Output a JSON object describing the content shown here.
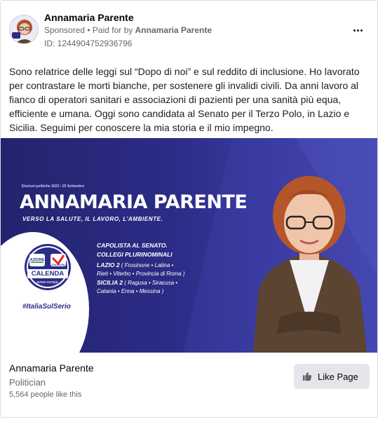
{
  "advertiser": {
    "name": "Annamaria Parente",
    "sponsored_label": "Sponsored",
    "paid_prefix": " • Paid for by ",
    "paid_by": "Annamaria Parente",
    "ad_id": "ID: 1244904752936796"
  },
  "post": {
    "body": "Sono relatrice delle leggi sul “Dopo di noi” e sul reddito di inclusione. Ho lavorato per contrastare le morti bianche, per sostenere gli invalidi civili. Da anni lavoro al fianco di operatori sanitari e associazioni di pazienti per una sanità più equa, efficiente e umana. Oggi sono candidata al Senato per il Terzo Polo, in Lazio e Sicilia. Seguimi per conoscere la mia storia e il mio impegno."
  },
  "banner": {
    "subtitle": "Elezioni politiche 2022 • 25 Settembre",
    "name": "ANNAMARIA PARENTE",
    "tagline": "VERSO LA SALUTE, IL LAVORO, L’AMBIENTE.",
    "capolista_line1": "CAPOLISTA AL SENATO.",
    "capolista_line2": "COLLEGI PLURINOMINALI",
    "lazio_label": "LAZIO 2",
    "lazio_detail1": " ( Frosinone • Latina •",
    "lazio_detail2": "Rieti • Viterbo • Provincia di Roma )",
    "sicilia_label": "SICILIA 2",
    "sicilia_detail1": " ( Ragusa • Siracusa •",
    "sicilia_detail2": "Catania • Enna • Messina )",
    "logo_azione": "AZIONE",
    "logo_italiaviva": "ITALIAVIVA",
    "logo_calenda": "CALENDA",
    "logo_renew": "renew europe.",
    "hashtag": "#ItaliaSulSerio",
    "colors": {
      "navy": "#2b2c86",
      "accent_red": "#e32526",
      "accent_green": "#4caf50"
    }
  },
  "page": {
    "name": "Annamaria Parente",
    "category": "Politician",
    "likes": "5,564 people like this",
    "like_button": "Like Page"
  },
  "icons": [
    "more-options-icon",
    "thumbs-up-icon"
  ]
}
